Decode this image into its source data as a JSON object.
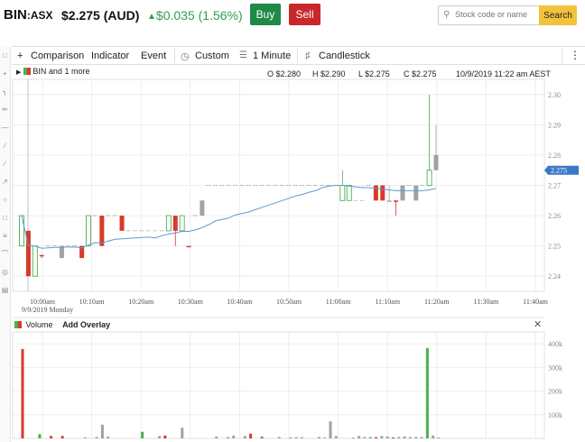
{
  "header": {
    "symbol": "BIN",
    "exchange": ":ASX",
    "price": "$2.275 (AUD)",
    "change": "$0.035 (1.56%)",
    "buy_label": "Buy",
    "sell_label": "Sell",
    "search_placeholder": "Stock code or name",
    "search_label": "Search"
  },
  "toolbar": {
    "comparison": "Comparison",
    "indicator": "Indicator",
    "event": "Event",
    "custom": "Custom",
    "interval": "1 Minute",
    "chart_type": "Candlestick"
  },
  "legend": {
    "series": "BIN and 1 more",
    "open": "O $2.280",
    "high": "H $2.290",
    "low": "L $2.275",
    "close": "C $2.275",
    "datetime": "10/9/2019 11:22 am AEST"
  },
  "volume_panel": {
    "label": "Volume",
    "overlay": "Add Overlay"
  },
  "colors": {
    "up": "#4caf50",
    "down": "#d83a2a",
    "neutral": "#9ea3a8",
    "ma": "#5b9bd5",
    "buy": "#1e8a45",
    "sell": "#c8272b",
    "search": "#f2c23c"
  },
  "chart_data": {
    "type": "candlestick",
    "ylim": [
      2.235,
      2.305
    ],
    "y_ticks": [
      "2.30",
      "2.29",
      "2.28",
      "2.27",
      "2.26",
      "2.25",
      "2.24"
    ],
    "current_price_label": "2.275",
    "x_ticks": [
      "10:00am",
      "10:10am",
      "10:20am",
      "10:30am",
      "10:40am",
      "10:50am",
      "11:00am",
      "11:10am",
      "11:20am",
      "11:30am",
      "11:40am"
    ],
    "date_label": "9/9/2019 Monday",
    "candles": [
      {
        "o": 2.25,
        "h": 2.26,
        "l": 2.25,
        "c": 2.26,
        "d": "up"
      },
      {
        "o": 2.255,
        "h": 2.255,
        "l": 2.24,
        "c": 2.24,
        "d": "down"
      },
      {
        "o": 2.24,
        "h": 2.25,
        "l": 2.24,
        "c": 2.25,
        "d": "up"
      },
      {
        "o": 2.247,
        "h": 2.247,
        "l": 2.246,
        "c": 2.247,
        "d": "down"
      },
      {
        "o": 2.25,
        "h": 2.25,
        "l": 2.25,
        "c": 2.25,
        "d": "flat"
      },
      {
        "o": 2.25,
        "h": 2.25,
        "l": 2.25,
        "c": 2.25,
        "d": "flat"
      },
      {
        "o": 2.246,
        "h": 2.25,
        "l": 2.246,
        "c": 2.25,
        "d": "neutral"
      },
      {
        "o": 2.25,
        "h": 2.25,
        "l": 2.25,
        "c": 2.25,
        "d": "flat"
      },
      {
        "o": 2.25,
        "h": 2.25,
        "l": 2.25,
        "c": 2.25,
        "d": "flat"
      },
      {
        "o": 2.25,
        "h": 2.25,
        "l": 2.246,
        "c": 2.246,
        "d": "down"
      },
      {
        "o": 2.25,
        "h": 2.26,
        "l": 2.25,
        "c": 2.26,
        "d": "up"
      },
      {
        "o": 2.26,
        "h": 2.26,
        "l": 2.26,
        "c": 2.26,
        "d": "flat"
      },
      {
        "o": 2.26,
        "h": 2.26,
        "l": 2.25,
        "c": 2.25,
        "d": "down"
      },
      {
        "o": 2.26,
        "h": 2.26,
        "l": 2.26,
        "c": 2.26,
        "d": "flat"
      },
      {
        "o": 2.26,
        "h": 2.26,
        "l": 2.26,
        "c": 2.26,
        "d": "flat"
      },
      {
        "o": 2.26,
        "h": 2.26,
        "l": 2.255,
        "c": 2.255,
        "d": "down"
      },
      {
        "o": 2.255,
        "h": 2.255,
        "l": 2.255,
        "c": 2.255,
        "d": "flat"
      },
      {
        "o": 2.255,
        "h": 2.255,
        "l": 2.255,
        "c": 2.255,
        "d": "flat"
      },
      {
        "o": 2.255,
        "h": 2.255,
        "l": 2.255,
        "c": 2.255,
        "d": "flat"
      },
      {
        "o": 2.255,
        "h": 2.255,
        "l": 2.255,
        "c": 2.255,
        "d": "flat"
      },
      {
        "o": 2.255,
        "h": 2.255,
        "l": 2.255,
        "c": 2.255,
        "d": "flat"
      },
      {
        "o": 2.255,
        "h": 2.255,
        "l": 2.255,
        "c": 2.255,
        "d": "flat"
      },
      {
        "o": 2.255,
        "h": 2.26,
        "l": 2.255,
        "c": 2.26,
        "d": "up"
      },
      {
        "o": 2.26,
        "h": 2.26,
        "l": 2.25,
        "c": 2.255,
        "d": "down"
      },
      {
        "o": 2.255,
        "h": 2.26,
        "l": 2.255,
        "c": 2.26,
        "d": "up"
      },
      {
        "o": 2.25,
        "h": 2.25,
        "l": 2.25,
        "c": 2.25,
        "d": "down"
      },
      {
        "o": 2.26,
        "h": 2.26,
        "l": 2.26,
        "c": 2.26,
        "d": "flat"
      },
      {
        "o": 2.26,
        "h": 2.265,
        "l": 2.26,
        "c": 2.265,
        "d": "neutral"
      },
      {
        "o": 2.27,
        "h": 2.27,
        "l": 2.27,
        "c": 2.27,
        "d": "flat"
      },
      {
        "o": 2.27,
        "h": 2.27,
        "l": 2.27,
        "c": 2.27,
        "d": "flat"
      },
      {
        "o": 2.27,
        "h": 2.27,
        "l": 2.27,
        "c": 2.27,
        "d": "flat"
      },
      {
        "o": 2.27,
        "h": 2.27,
        "l": 2.27,
        "c": 2.27,
        "d": "flat"
      },
      {
        "o": 2.27,
        "h": 2.27,
        "l": 2.27,
        "c": 2.27,
        "d": "flat"
      },
      {
        "o": 2.27,
        "h": 2.27,
        "l": 2.27,
        "c": 2.27,
        "d": "flat"
      },
      {
        "o": 2.27,
        "h": 2.27,
        "l": 2.27,
        "c": 2.27,
        "d": "flat"
      },
      {
        "o": 2.27,
        "h": 2.27,
        "l": 2.27,
        "c": 2.27,
        "d": "flat"
      },
      {
        "o": 2.27,
        "h": 2.27,
        "l": 2.27,
        "c": 2.27,
        "d": "flat"
      },
      {
        "o": 2.27,
        "h": 2.27,
        "l": 2.27,
        "c": 2.27,
        "d": "flat"
      },
      {
        "o": 2.27,
        "h": 2.27,
        "l": 2.27,
        "c": 2.27,
        "d": "flat"
      },
      {
        "o": 2.27,
        "h": 2.27,
        "l": 2.27,
        "c": 2.27,
        "d": "flat"
      },
      {
        "o": 2.27,
        "h": 2.27,
        "l": 2.27,
        "c": 2.27,
        "d": "flat"
      },
      {
        "o": 2.27,
        "h": 2.27,
        "l": 2.27,
        "c": 2.27,
        "d": "flat"
      },
      {
        "o": 2.27,
        "h": 2.27,
        "l": 2.27,
        "c": 2.27,
        "d": "flat"
      },
      {
        "o": 2.27,
        "h": 2.27,
        "l": 2.27,
        "c": 2.27,
        "d": "flat"
      },
      {
        "o": 2.27,
        "h": 2.27,
        "l": 2.27,
        "c": 2.27,
        "d": "flat"
      },
      {
        "o": 2.27,
        "h": 2.27,
        "l": 2.27,
        "c": 2.27,
        "d": "flat"
      },
      {
        "o": 2.27,
        "h": 2.27,
        "l": 2.27,
        "c": 2.27,
        "d": "flat"
      },
      {
        "o": 2.27,
        "h": 2.27,
        "l": 2.27,
        "c": 2.27,
        "d": "flat"
      },
      {
        "o": 2.265,
        "h": 2.275,
        "l": 2.265,
        "c": 2.27,
        "d": "up"
      },
      {
        "o": 2.27,
        "h": 2.27,
        "l": 2.265,
        "c": 2.265,
        "d": "up"
      },
      {
        "o": 2.27,
        "h": 2.27,
        "l": 2.265,
        "c": 2.265,
        "d": "flat"
      },
      {
        "o": 2.27,
        "h": 2.27,
        "l": 2.265,
        "c": 2.265,
        "d": "flat"
      },
      {
        "o": 2.27,
        "h": 2.27,
        "l": 2.27,
        "c": 2.27,
        "d": "flat"
      },
      {
        "o": 2.27,
        "h": 2.27,
        "l": 2.265,
        "c": 2.265,
        "d": "down"
      },
      {
        "o": 2.27,
        "h": 2.27,
        "l": 2.265,
        "c": 2.265,
        "d": "down"
      },
      {
        "o": 2.265,
        "h": 2.27,
        "l": 2.265,
        "c": 2.265,
        "d": "neutral"
      },
      {
        "o": 2.265,
        "h": 2.265,
        "l": 2.26,
        "c": 2.265,
        "d": "down"
      },
      {
        "o": 2.265,
        "h": 2.27,
        "l": 2.265,
        "c": 2.27,
        "d": "neutral"
      },
      {
        "o": 2.27,
        "h": 2.27,
        "l": 2.27,
        "c": 2.27,
        "d": "flat"
      },
      {
        "o": 2.265,
        "h": 2.27,
        "l": 2.265,
        "c": 2.27,
        "d": "neutral"
      },
      {
        "o": 2.27,
        "h": 2.27,
        "l": 2.27,
        "c": 2.27,
        "d": "flat"
      },
      {
        "o": 2.27,
        "h": 2.3,
        "l": 2.27,
        "c": 2.275,
        "d": "up"
      },
      {
        "o": 2.275,
        "h": 2.29,
        "l": 2.275,
        "c": 2.28,
        "d": "neutral"
      }
    ],
    "volume_ticks": [
      "400k",
      "300k",
      "200k",
      "100k"
    ],
    "volume_max": 450000,
    "volumes": [
      {
        "v": 378000,
        "d": "down"
      },
      {
        "v": 0,
        "d": "flat"
      },
      {
        "v": 0,
        "d": "flat"
      },
      {
        "v": 18000,
        "d": "up"
      },
      {
        "v": 0,
        "d": "flat"
      },
      {
        "v": 10000,
        "d": "down"
      },
      {
        "v": 0,
        "d": "flat"
      },
      {
        "v": 10000,
        "d": "down"
      },
      {
        "v": 0,
        "d": "flat"
      },
      {
        "v": 0,
        "d": "flat"
      },
      {
        "v": 0,
        "d": "flat"
      },
      {
        "v": 4000,
        "d": "neutral"
      },
      {
        "v": 0,
        "d": "flat"
      },
      {
        "v": 6000,
        "d": "neutral"
      },
      {
        "v": 58000,
        "d": "neutral"
      },
      {
        "v": 8000,
        "d": "neutral"
      },
      {
        "v": 0,
        "d": "flat"
      },
      {
        "v": 0,
        "d": "flat"
      },
      {
        "v": 0,
        "d": "flat"
      },
      {
        "v": 0,
        "d": "flat"
      },
      {
        "v": 0,
        "d": "flat"
      },
      {
        "v": 28000,
        "d": "up"
      },
      {
        "v": 0,
        "d": "flat"
      },
      {
        "v": 0,
        "d": "flat"
      },
      {
        "v": 10000,
        "d": "neutral"
      },
      {
        "v": 12000,
        "d": "down"
      },
      {
        "v": 0,
        "d": "flat"
      },
      {
        "v": 0,
        "d": "flat"
      },
      {
        "v": 45000,
        "d": "neutral"
      },
      {
        "v": 0,
        "d": "flat"
      },
      {
        "v": 0,
        "d": "flat"
      },
      {
        "v": 0,
        "d": "flat"
      },
      {
        "v": 0,
        "d": "flat"
      },
      {
        "v": 0,
        "d": "flat"
      },
      {
        "v": 8000,
        "d": "neutral"
      },
      {
        "v": 0,
        "d": "flat"
      },
      {
        "v": 6000,
        "d": "neutral"
      },
      {
        "v": 12000,
        "d": "neutral"
      },
      {
        "v": 0,
        "d": "flat"
      },
      {
        "v": 10000,
        "d": "neutral"
      },
      {
        "v": 20000,
        "d": "down"
      },
      {
        "v": 0,
        "d": "flat"
      },
      {
        "v": 8000,
        "d": "up"
      },
      {
        "v": 0,
        "d": "flat"
      },
      {
        "v": 0,
        "d": "flat"
      },
      {
        "v": 6000,
        "d": "neutral"
      },
      {
        "v": 0,
        "d": "flat"
      },
      {
        "v": 4000,
        "d": "neutral"
      },
      {
        "v": 5000,
        "d": "neutral"
      },
      {
        "v": 5000,
        "d": "neutral"
      },
      {
        "v": 0,
        "d": "flat"
      },
      {
        "v": 0,
        "d": "flat"
      },
      {
        "v": 6000,
        "d": "neutral"
      },
      {
        "v": 4000,
        "d": "neutral"
      },
      {
        "v": 72000,
        "d": "neutral"
      },
      {
        "v": 10000,
        "d": "neutral"
      },
      {
        "v": 0,
        "d": "flat"
      },
      {
        "v": 0,
        "d": "flat"
      },
      {
        "v": 4000,
        "d": "neutral"
      },
      {
        "v": 10000,
        "d": "neutral"
      },
      {
        "v": 6000,
        "d": "neutral"
      },
      {
        "v": 6000,
        "d": "neutral"
      },
      {
        "v": 5000,
        "d": "down"
      },
      {
        "v": 10000,
        "d": "neutral"
      },
      {
        "v": 8000,
        "d": "neutral"
      },
      {
        "v": 4000,
        "d": "down"
      },
      {
        "v": 6000,
        "d": "neutral"
      },
      {
        "v": 8000,
        "d": "neutral"
      },
      {
        "v": 6000,
        "d": "neutral"
      },
      {
        "v": 6000,
        "d": "neutral"
      },
      {
        "v": 6000,
        "d": "neutral"
      },
      {
        "v": 382000,
        "d": "up"
      },
      {
        "v": 12000,
        "d": "neutral"
      },
      {
        "v": 4000,
        "d": "neutral"
      }
    ]
  }
}
